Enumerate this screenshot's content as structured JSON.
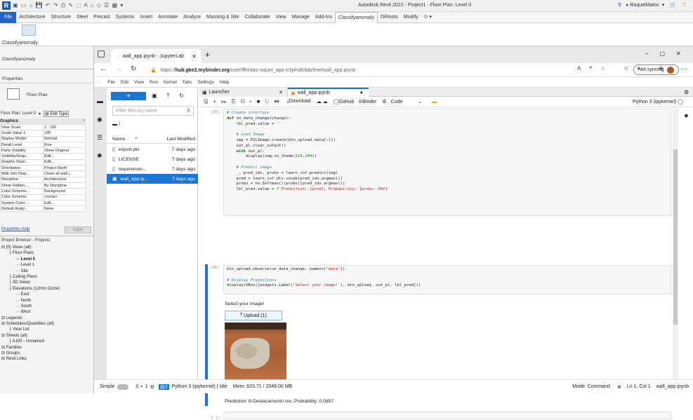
{
  "revit": {
    "app_title": "Autodesk Revit 2022 - Project1 - Floor Plan: Level 0",
    "user": "RaquelMatos",
    "ribbon_tabs": [
      "File",
      "Architecture",
      "Structure",
      "Steel",
      "Precast",
      "Systems",
      "Insert",
      "Annotate",
      "Analyze",
      "Massing & Site",
      "Collaborate",
      "View",
      "Manage",
      "Add-Ins",
      "Classifyanomaly",
      "DiRoots",
      "Modify"
    ],
    "active_tab": "Classifyanomaly",
    "panel_label": "Classifyanomaly",
    "panel_label2": "Classifyanomaly",
    "properties_title": "Properties",
    "floor_plan_type": "Floor Plan",
    "floor_plan_selector": "Floor Plan: Level 0",
    "edit_type": "Edit Type",
    "graphics_header": "Graphics",
    "props": [
      [
        "View Scale",
        "1 : 100"
      ],
      [
        "Scale Value 1:",
        "100"
      ],
      [
        "Display Model",
        "Normal"
      ],
      [
        "Detail Level",
        "Fine"
      ],
      [
        "Parts Visibility",
        "Show Original"
      ],
      [
        "Visibility/Grap...",
        "Edit..."
      ],
      [
        "Graphic Displ...",
        "Edit..."
      ],
      [
        "Orientation",
        "Project North"
      ],
      [
        "Wall Join Disp...",
        "Clean all wall j..."
      ],
      [
        "Discipline",
        "Architectural"
      ],
      [
        "Show Hidden ...",
        "By Discipline"
      ],
      [
        "Color Scheme...",
        "Background"
      ],
      [
        "Color Scheme",
        "<none>"
      ],
      [
        "System Color ...",
        "Edit..."
      ],
      [
        "Default Analy...",
        "None"
      ]
    ],
    "properties_help": "Properties help",
    "apply": "Apply",
    "project_browser_title": "Project Browser - Project1",
    "tree": [
      {
        "t": "[0] Views (all)",
        "d": 0
      },
      {
        "t": "Floor Plans",
        "d": 1
      },
      {
        "t": "Level 0",
        "d": 2,
        "b": true
      },
      {
        "t": "Level 1",
        "d": 2
      },
      {
        "t": "Site",
        "d": 2
      },
      {
        "t": "Ceiling Plans",
        "d": 1
      },
      {
        "t": "3D Views",
        "d": 1
      },
      {
        "t": "Elevations (12mm Circle)",
        "d": 1
      },
      {
        "t": "East",
        "d": 2
      },
      {
        "t": "North",
        "d": 2
      },
      {
        "t": "South",
        "d": 2
      },
      {
        "t": "West",
        "d": 2
      },
      {
        "t": "Legends",
        "d": 0
      },
      {
        "t": "Schedules/Quantities (all)",
        "d": 0
      },
      {
        "t": "View List",
        "d": 1
      },
      {
        "t": "Sheets (all)",
        "d": 0
      },
      {
        "t": "A100 - Unnamed",
        "d": 1
      },
      {
        "t": "Families",
        "d": 0
      },
      {
        "t": "Groups",
        "d": 0
      },
      {
        "t": "Revit Links",
        "d": 0
      }
    ]
  },
  "edge": {
    "tab_title": "wall_app.ipynb - JupyterLab",
    "url_prefix": "https://",
    "url_host": "hub.gke2.mybinder.org",
    "url_path": "/user/fffreitas-raquel_app-xi3j4hd6/lab/tree/wall_app.ipynb",
    "sync": "Not syncing"
  },
  "jupyter": {
    "menu": [
      "File",
      "Edit",
      "View",
      "Run",
      "Kernel",
      "Tabs",
      "Settings",
      "Help"
    ],
    "filter_placeholder": "Filter files by name",
    "path": "/",
    "col_name": "Name",
    "col_modified": "Last Modified",
    "files": [
      {
        "name": "export.pkl",
        "modified": "7 days ago"
      },
      {
        "name": "LICENSE",
        "modified": "7 days ago"
      },
      {
        "name": "requiremen...",
        "modified": "7 days ago"
      },
      {
        "name": "wall_app.ip...",
        "modified": "7 days ago"
      }
    ],
    "tab_launcher": "Launcher",
    "tab_notebook": "wall_app.ipynb",
    "tb_download": "Download",
    "tb_github": "GitHub",
    "tb_binder": "Binder",
    "tb_celltype": "Code",
    "kernel": "Python 3 (ipykernel)",
    "cell3_prompt": "[3]:",
    "cell4_prompt": "[4]:",
    "empty_prompt": "[ ]:",
    "select_label": "Select your image!",
    "upload_btn": "Upload (1)",
    "prediction": "Prediction: 8-Destacamento rev; Probability: 0.0857",
    "status_mode": "Simple",
    "status_zero": "0",
    "status_one": "1",
    "status_kernel": "Python 3 (ipykernel) | Idle",
    "status_mem": "Mem: 623.71 / 2048.00 MB",
    "status_cmd": "Mode: Command",
    "status_pos": "Ln 1, Col 1",
    "status_file": "wall_app.ipynb"
  },
  "colors": {
    "revit_blue": "#2563c7",
    "jupyter_blue": "#1976d2",
    "selected_row": "#1976d2"
  }
}
